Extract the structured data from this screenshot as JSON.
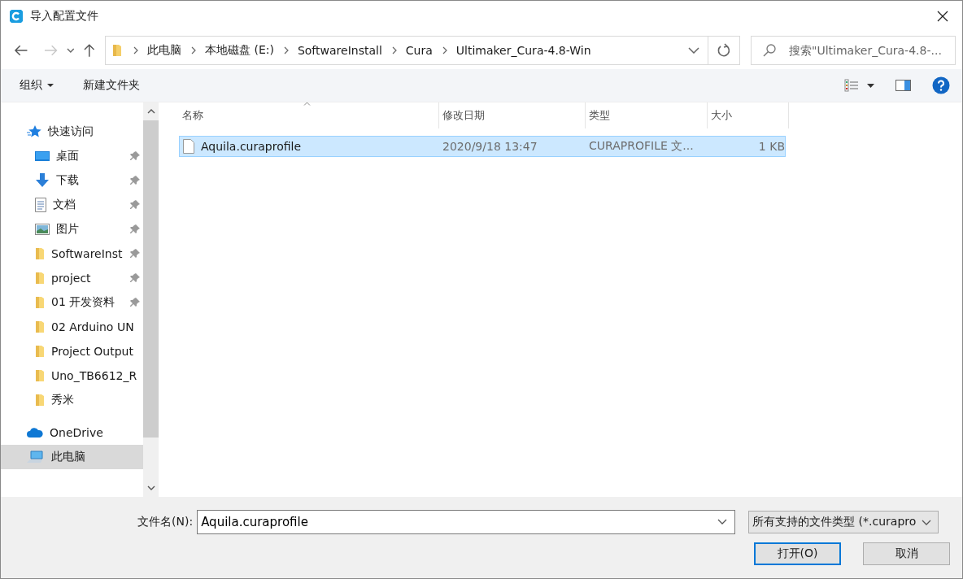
{
  "window": {
    "title": "导入配置文件"
  },
  "address": {
    "crumbs": [
      "此电脑",
      "本地磁盘 (E:)",
      "SoftwareInstall",
      "Cura",
      "Ultimaker_Cura-4.8-Win"
    ]
  },
  "search": {
    "placeholder": "搜索\"Ultimaker_Cura-4.8-..."
  },
  "toolbar": {
    "organize": "组织",
    "new_folder": "新建文件夹"
  },
  "sidebar": {
    "items": [
      {
        "label": "快速访问",
        "kind": "star",
        "pinned": false,
        "selected": false,
        "group": true
      },
      {
        "label": "桌面",
        "kind": "desktop",
        "pinned": true,
        "selected": false,
        "group": false
      },
      {
        "label": "下载",
        "kind": "download",
        "pinned": true,
        "selected": false,
        "group": false
      },
      {
        "label": "文档",
        "kind": "document",
        "pinned": true,
        "selected": false,
        "group": false
      },
      {
        "label": "图片",
        "kind": "pictures",
        "pinned": true,
        "selected": false,
        "group": false
      },
      {
        "label": "SoftwareInst",
        "kind": "folder",
        "pinned": true,
        "selected": false,
        "group": false
      },
      {
        "label": "project",
        "kind": "folder",
        "pinned": true,
        "selected": false,
        "group": false
      },
      {
        "label": "01 开发资料",
        "kind": "folder",
        "pinned": true,
        "selected": false,
        "group": false
      },
      {
        "label": "02 Arduino UN",
        "kind": "folder",
        "pinned": false,
        "selected": false,
        "group": false
      },
      {
        "label": "Project Output",
        "kind": "folder",
        "pinned": false,
        "selected": false,
        "group": false
      },
      {
        "label": "Uno_TB6612_R",
        "kind": "folder",
        "pinned": false,
        "selected": false,
        "group": false
      },
      {
        "label": "秀米",
        "kind": "folder",
        "pinned": false,
        "selected": false,
        "group": false
      },
      {
        "label": "OneDrive",
        "kind": "cloud",
        "pinned": false,
        "selected": false,
        "group": true
      },
      {
        "label": "此电脑",
        "kind": "computer",
        "pinned": false,
        "selected": true,
        "group": true
      }
    ]
  },
  "table": {
    "columns": [
      "名称",
      "修改日期",
      "类型",
      "大小"
    ],
    "rows": [
      {
        "name": "Aquila.curaprofile",
        "modified": "2020/9/18 13:47",
        "type": "CURAPROFILE 文...",
        "size": "1 KB",
        "selected": true
      }
    ]
  },
  "footer": {
    "filename_label": "文件名(N):",
    "filename": "Aquila.curaprofile",
    "filter": "所有支持的文件类型 (*.curapro",
    "open": "打开(O)",
    "cancel": "取消"
  }
}
